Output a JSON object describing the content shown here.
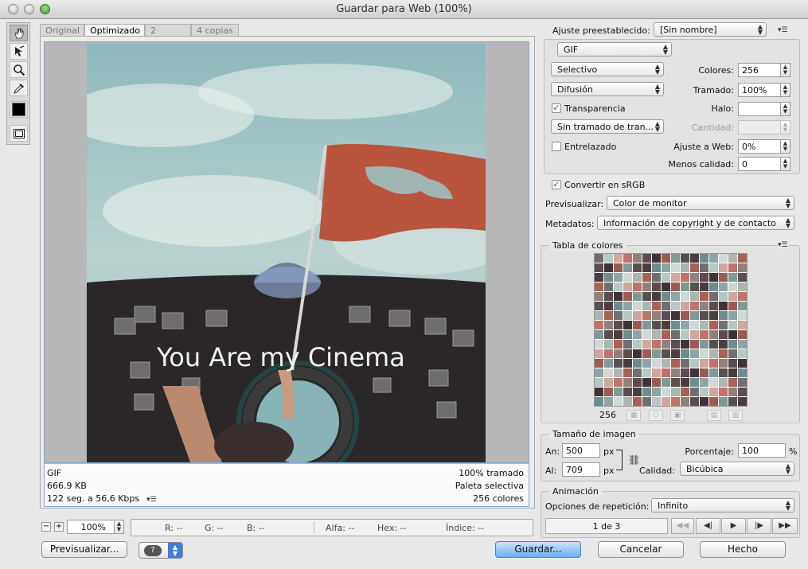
{
  "window": {
    "title": "Guardar para Web (100%)"
  },
  "tabs": [
    {
      "label": "Original",
      "active": false
    },
    {
      "label": "Optimizado",
      "active": true
    },
    {
      "label": "2 copias",
      "active": false
    },
    {
      "label": "4 copias",
      "active": false
    }
  ],
  "tools": [
    "hand-icon",
    "slice-select-icon",
    "zoom-icon",
    "eyedropper-icon",
    "color-swatch-icon",
    "toggle-slices-icon"
  ],
  "image": {
    "caption": "You Are my Cinema"
  },
  "info": {
    "format": "GIF",
    "size": "666.9 KB",
    "time": "122 seg. a 56,6 Kbps",
    "dither": "100% tramado",
    "palette": "Paleta selectiva",
    "colors": "256 colores"
  },
  "status": {
    "zoom": "100%",
    "r": "R: --",
    "g": "G: --",
    "b": "B: --",
    "alpha": "Alfa: --",
    "hex": "Hex: --",
    "index": "Índice: --"
  },
  "settings": {
    "preset_label": "Ajuste preestablecido:",
    "preset_value": "[Sin nombre]",
    "format": "GIF",
    "reduction": "Selectivo",
    "dither_algo": "Difusión",
    "colors_label": "Colores:",
    "colors_value": "256",
    "dither_label": "Tramado:",
    "dither_value": "100%",
    "transparency_label": "Transparencia",
    "transparency_checked": true,
    "matte_label": "Halo:",
    "matte_value": "",
    "transparency_dither": "Sin tramado de tran...",
    "amount_label": "Cantidad:",
    "interlaced_label": "Entrelazado",
    "interlaced_checked": false,
    "web_snap_label": "Ajuste a Web:",
    "web_snap_value": "0%",
    "lossy_label": "Menos calidad:",
    "lossy_value": "0",
    "convert_srgb_label": "Convertir en sRGB",
    "convert_srgb_checked": true,
    "preview_label": "Previsualizar:",
    "preview_value": "Color de monitor",
    "metadata_label": "Metadatos:",
    "metadata_value": "Información de copyright y de contacto"
  },
  "color_table": {
    "title": "Tabla de colores",
    "count": "256",
    "colors": [
      "#6f6f6f",
      "#9c5a55",
      "#aab7b1",
      "#5d4b4f",
      "#8ea5a5",
      "#c0736a",
      "#4a3c3f",
      "#b7c7c4",
      "#7e9a97",
      "#a86155",
      "#3f3335",
      "#cfd8d5",
      "#91817c",
      "#6e8c8c",
      "#d0a7a0",
      "#58504f"
    ]
  },
  "image_size": {
    "title": "Tamaño de imagen",
    "width_label": "An:",
    "width": "500",
    "height_label": "Al:",
    "height": "709",
    "unit": "px",
    "percent_label": "Porcentaje:",
    "percent": "100",
    "percent_unit": "%",
    "quality_label": "Calidad:",
    "quality": "Bicúbica"
  },
  "animation": {
    "title": "Animación",
    "loop_label": "Opciones de repetición:",
    "loop_value": "Infinito",
    "frame": "1 de 3"
  },
  "buttons": {
    "preview": "Previsualizar...",
    "save": "Guardar...",
    "cancel": "Cancelar",
    "done": "Hecho"
  }
}
